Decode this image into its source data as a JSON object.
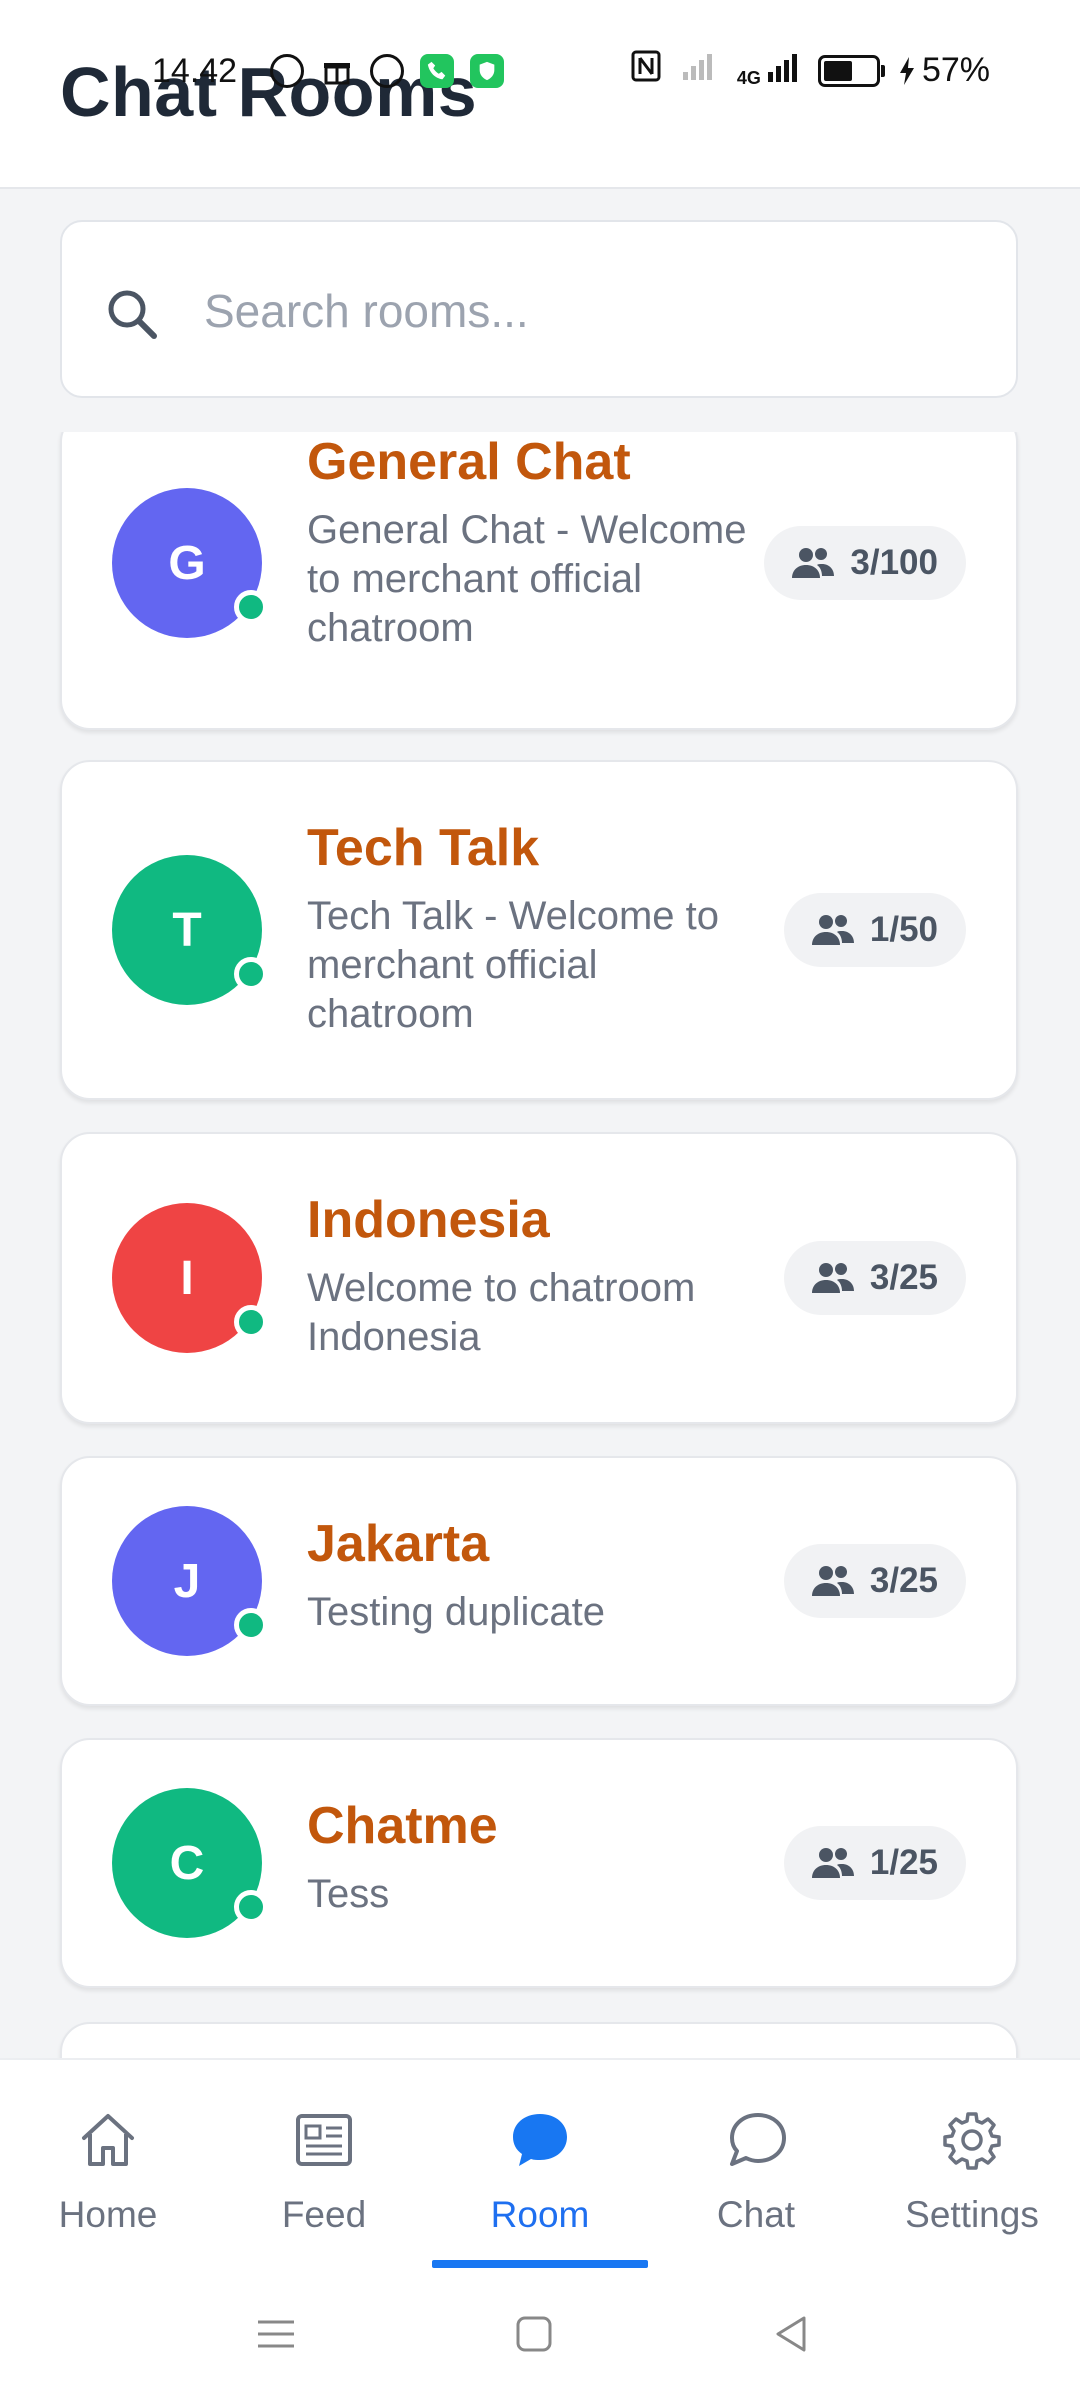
{
  "status_bar": {
    "time": "14.42",
    "battery": "57%",
    "network": "4G"
  },
  "header": {
    "title": "Chat Rooms"
  },
  "search": {
    "placeholder": "Search rooms..."
  },
  "rooms": [
    {
      "initial": "G",
      "name": "General Chat",
      "description": "General Chat - Welcome to merchant official chatroom",
      "members": "3/100",
      "color": "#6366f1",
      "online": true
    },
    {
      "initial": "T",
      "name": "Tech Talk",
      "description": "Tech Talk - Welcome to merchant official chatroom",
      "members": "1/50",
      "color": "#10b981",
      "online": true
    },
    {
      "initial": "I",
      "name": "Indonesia",
      "description": "Welcome to chatroom Indonesia",
      "members": "3/25",
      "color": "#ef4444",
      "online": true
    },
    {
      "initial": "J",
      "name": "Jakarta",
      "description": "Testing duplicate",
      "members": "3/25",
      "color": "#6366f1",
      "online": true
    },
    {
      "initial": "C",
      "name": "Chatme",
      "description": "Tess",
      "members": "1/25",
      "color": "#10b981",
      "online": true
    }
  ],
  "bottom_nav": {
    "items": [
      {
        "label": "Home",
        "icon": "home-icon"
      },
      {
        "label": "Feed",
        "icon": "feed-icon"
      },
      {
        "label": "Room",
        "icon": "room-icon",
        "active": true
      },
      {
        "label": "Chat",
        "icon": "chat-icon"
      },
      {
        "label": "Settings",
        "icon": "settings-icon"
      }
    ]
  },
  "colors": {
    "accent": "#1877f2",
    "room_name": "#c2570c",
    "online": "#10b981"
  }
}
